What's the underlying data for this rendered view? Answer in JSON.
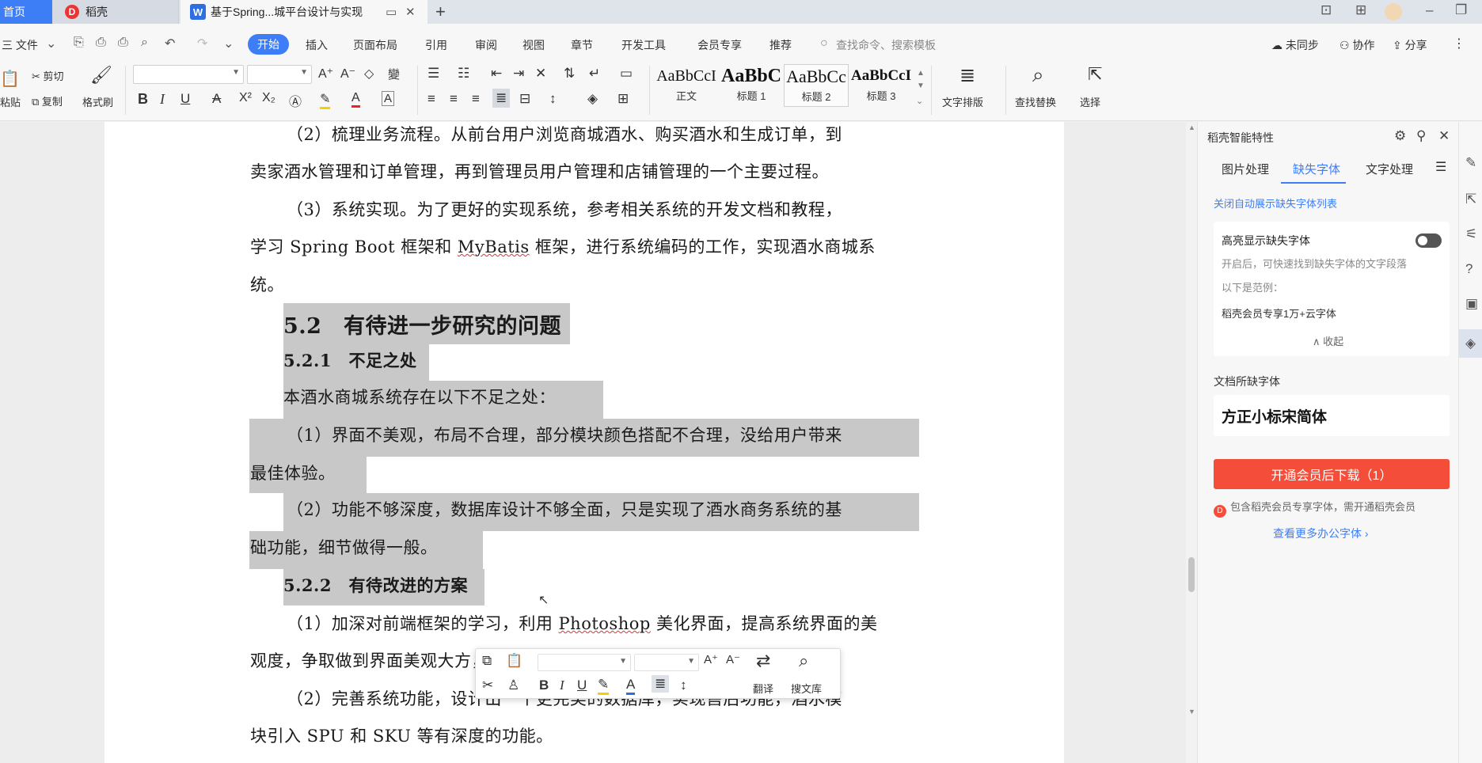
{
  "tabs": {
    "home": "首页",
    "daoke": "稻壳",
    "doc": "基于Spring...城平台设计与实现"
  },
  "menu": {
    "file": "三 文件",
    "items": [
      "开始",
      "插入",
      "页面布局",
      "引用",
      "审阅",
      "视图",
      "章节",
      "开发工具",
      "会员专享",
      "推荐"
    ],
    "search_placeholder": "查找命令、搜索模板",
    "not_synced": "未同步",
    "collab": "协作",
    "share": "分享"
  },
  "ribbon": {
    "paste": "粘贴",
    "cut": "剪切",
    "copy": "复制",
    "format_painter": "格式刷",
    "styles": [
      {
        "preview": "AaBbCcI",
        "label": "正文"
      },
      {
        "preview": "AaBbC",
        "label": "标题 1"
      },
      {
        "preview": "AaBbCc",
        "label": "标题 2"
      },
      {
        "preview": "AaBbCcI",
        "label": "标题 3"
      }
    ],
    "text_layout": "文字排版",
    "find_replace": "查找替换",
    "select": "选择"
  },
  "document": {
    "l1": "（2）梳理业务流程。从前台用户浏览商城酒水、购买酒水和生成订单，到",
    "l2": "卖家酒水管理和订单管理，再到管理员用户管理和店铺管理的一个主要过程。",
    "l3": "（3）系统实现。为了更好的实现系统，参考相关系统的开发文档和教程，",
    "l4_a": "学习 Spring Boot 框架和 ",
    "l4_b": "MyBatis",
    "l4_c": " 框架，进行系统编码的工作，实现酒水商城系",
    "l5": "统。",
    "h52": "5.2　有待进一步研究的问题",
    "h521": "5.2.1　不足之处",
    "l6": "本酒水商城系统存在以下不足之处：",
    "l7": "（1）界面不美观，布局不合理，部分模块颜色搭配不合理，没给用户带来",
    "l8": "最佳体验。",
    "l9": "（2）功能不够深度，数据库设计不够全面，只是实现了酒水商务系统的基",
    "l10": "础功能，细节做得一般。",
    "h522": "5.2.2　有待改进的方案",
    "l11_a": "（1）加深对前端框架的学习，利用 ",
    "l11_b": "Photoshop",
    "l11_c": " 美化界面，提高系统界面的美",
    "l12": "观度，争取做到界面美观大方，操作简单，提升用户体验。",
    "l13": "（2）完善系统功能，设计出一个更完美的数据库，实现售后功能，酒水模",
    "l14": "块引入 SPU 和 SKU 等有深度的功能。"
  },
  "minibar": {
    "translate": "翻译",
    "search_lib": "搜文库"
  },
  "pane": {
    "title": "稻壳智能特性",
    "tabs": [
      "图片处理",
      "缺失字体",
      "文字处理"
    ],
    "auto_close": "关闭自动展示缺失字体列表",
    "highlight_title": "高亮显示缺失字体",
    "desc": "开启后，可快速找到缺失字体的文字段落",
    "example_label": "以下是范例：",
    "example": "稻壳会员专享1万+云字体",
    "collapse": "收起",
    "missing_title": "文档所缺字体",
    "missing_font": "方正小标宋简体",
    "download": "开通会员后下载（1）",
    "note": "包含稻壳会员专享字体，需开通稻壳会员",
    "more": "查看更多办公字体"
  }
}
